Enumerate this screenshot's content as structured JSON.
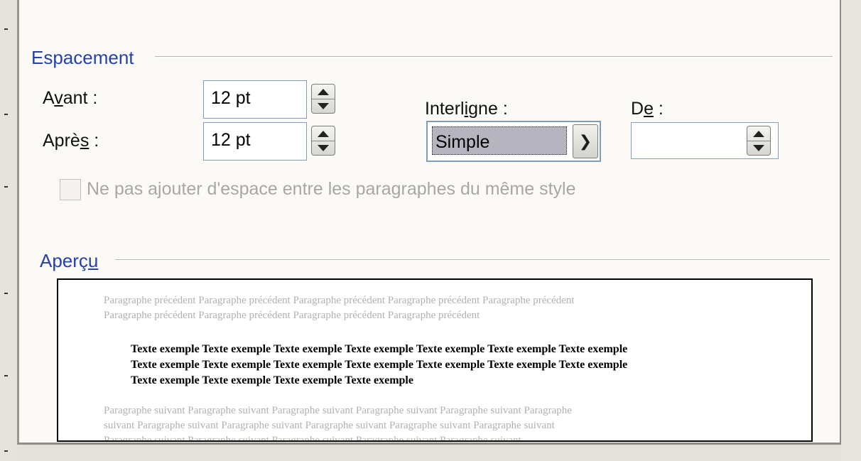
{
  "spacing": {
    "title": "Espacement",
    "before": {
      "label_pre": "A",
      "label_u": "v",
      "label_post": "ant :",
      "value": "12 pt"
    },
    "after": {
      "label_pre": "Aprè",
      "label_u": "s",
      "label_post": " :",
      "value": "12 pt"
    },
    "line_spacing": {
      "label_pre": "Interl",
      "label_u": "i",
      "label_post": "gne :",
      "value": "Simple"
    },
    "at": {
      "label_pre": "D",
      "label_u": "e",
      "label_post": " :",
      "value": ""
    },
    "no_space_checkbox": {
      "label": "Ne pas ajouter d'espace entre les paragraphes du même style",
      "checked": false,
      "enabled": false
    }
  },
  "preview": {
    "title_pre": "Aperç",
    "title_u": "u",
    "previous_lines": [
      "Paragraphe précédent Paragraphe précédent Paragraphe précédent Paragraphe précédent Paragraphe précédent",
      "Paragraphe précédent Paragraphe précédent Paragraphe précédent Paragraphe précédent"
    ],
    "sample_lines": [
      "Texte exemple Texte exemple Texte exemple Texte exemple Texte exemple Texte exemple Texte exemple",
      "Texte exemple Texte exemple Texte exemple Texte exemple Texte exemple Texte exemple Texte exemple",
      "Texte exemple Texte exemple Texte exemple Texte exemple"
    ],
    "next_lines": [
      "Paragraphe suivant Paragraphe suivant Paragraphe suivant Paragraphe suivant Paragraphe suivant Paragraphe",
      "suivant Paragraphe suivant Paragraphe suivant Paragraphe suivant Paragraphe suivant Paragraphe suivant",
      "Paragraphe suivant Paragraphe suivant Paragraphe suivant Paragraphe suivant Paragraphe suivant"
    ]
  },
  "icons": {
    "spin_up": "triangle-up-icon",
    "spin_down": "triangle-down-icon",
    "dropdown": "chevron-down-icon"
  },
  "colors": {
    "section_title": "#2442a8",
    "disabled_text": "#a9a7a2",
    "selection_bg": "#b6b4be",
    "field_border": "#7f9db9"
  }
}
